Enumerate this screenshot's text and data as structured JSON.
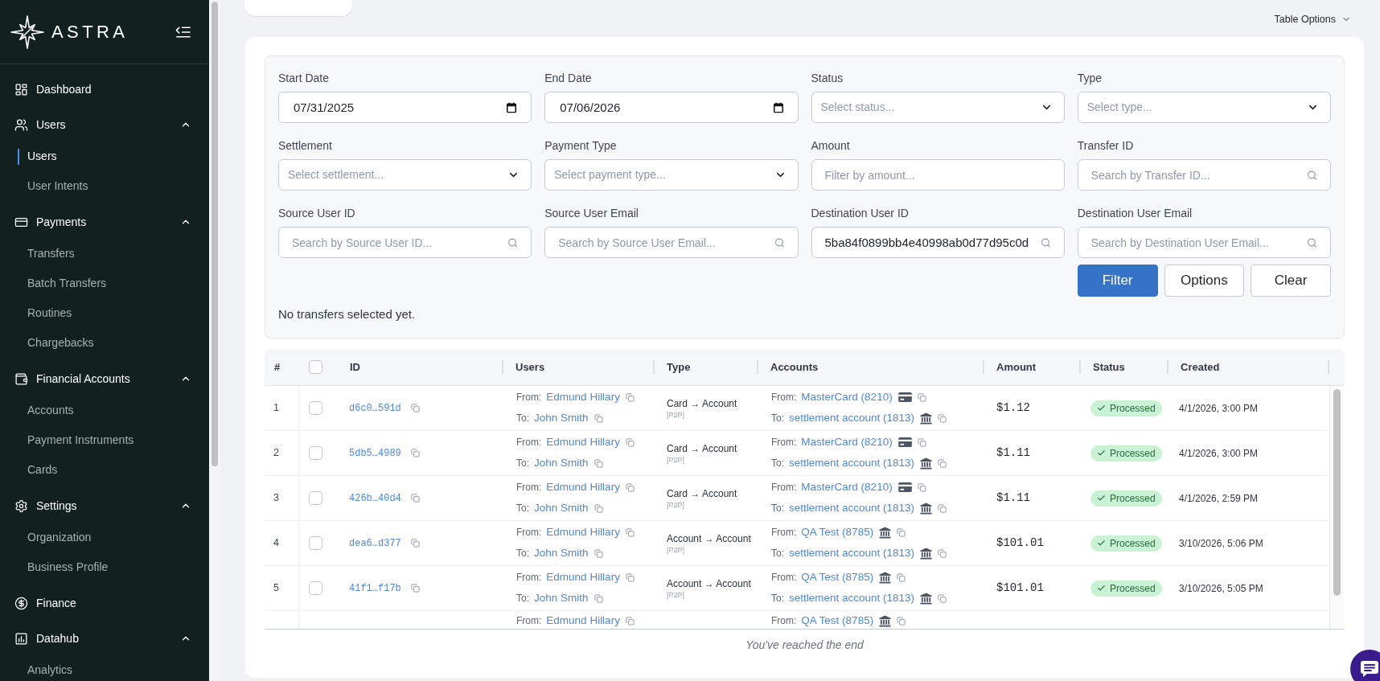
{
  "sidebar": {
    "logo": "ASTRA",
    "items": [
      {
        "label": "Dashboard",
        "kind": "link",
        "selected": false
      },
      {
        "label": "Users",
        "kind": "group",
        "expanded": true,
        "children": [
          {
            "label": "Users",
            "selected": true
          },
          {
            "label": "User Intents",
            "selected": false
          }
        ]
      },
      {
        "label": "Payments",
        "kind": "group",
        "expanded": true,
        "children": [
          {
            "label": "Transfers",
            "selected": false
          },
          {
            "label": "Batch Transfers",
            "selected": false
          },
          {
            "label": "Routines",
            "selected": false
          },
          {
            "label": "Chargebacks",
            "selected": false
          }
        ]
      },
      {
        "label": "Financial Accounts",
        "kind": "group",
        "expanded": true,
        "children": [
          {
            "label": "Accounts",
            "selected": false
          },
          {
            "label": "Payment Instruments",
            "selected": false
          },
          {
            "label": "Cards",
            "selected": false
          }
        ]
      },
      {
        "label": "Settings",
        "kind": "group",
        "expanded": true,
        "children": [
          {
            "label": "Organization",
            "selected": false
          },
          {
            "label": "Business Profile",
            "selected": false
          }
        ]
      },
      {
        "label": "Finance",
        "kind": "link",
        "selected": false
      },
      {
        "label": "Datahub",
        "kind": "group",
        "expanded": true,
        "children": [
          {
            "label": "Analytics",
            "selected": false
          }
        ]
      }
    ]
  },
  "toolbar": {
    "table_options": "Table Options"
  },
  "filters": {
    "fields": [
      {
        "label": "Start Date",
        "kind": "date",
        "value": "07/31/2025"
      },
      {
        "label": "End Date",
        "kind": "date",
        "value": "07/06/2026"
      },
      {
        "label": "Status",
        "kind": "select",
        "placeholder": "Select status..."
      },
      {
        "label": "Type",
        "kind": "select",
        "placeholder": "Select type..."
      },
      {
        "label": "Settlement",
        "kind": "select",
        "placeholder": "Select settlement..."
      },
      {
        "label": "Payment Type",
        "kind": "select",
        "placeholder": "Select payment type..."
      },
      {
        "label": "Amount",
        "kind": "text",
        "placeholder": "Filter by amount..."
      },
      {
        "label": "Transfer ID",
        "kind": "search",
        "placeholder": "Search by Transfer ID..."
      },
      {
        "label": "Source User ID",
        "kind": "search",
        "placeholder": "Search by Source User ID..."
      },
      {
        "label": "Source User Email",
        "kind": "search",
        "placeholder": "Search by Source User Email..."
      },
      {
        "label": "Destination User ID",
        "kind": "search",
        "value": "5ba84f0899bb4e40998ab0d77d95c0d"
      },
      {
        "label": "Destination User Email",
        "kind": "search",
        "placeholder": "Search by Destination User Email..."
      }
    ],
    "buttons": [
      {
        "label": "Filter",
        "kind": "primary"
      },
      {
        "label": "Options",
        "kind": "secondary"
      },
      {
        "label": "Clear",
        "kind": "secondary"
      }
    ],
    "selection_note": "No transfers selected yet."
  },
  "table": {
    "columns": [
      "#",
      "ID",
      "Users",
      "Type",
      "Accounts",
      "Amount",
      "Status",
      "Created"
    ],
    "header_checkbox": {
      "checked": false
    },
    "rows": [
      {
        "number": "1",
        "checked": false,
        "id": "d6c0…591d",
        "users": {
          "from": {
            "label": "From:",
            "name": "Edmund Hillary"
          },
          "to": {
            "label": "To:",
            "name": "John Smith"
          }
        },
        "type": {
          "text": "Card → Account",
          "tag": "[P2P]"
        },
        "accounts": {
          "from": {
            "label": "From:",
            "name": "MasterCard (8210)",
            "kind": "card"
          },
          "to": {
            "label": "To:",
            "name": "settlement account (1813)",
            "kind": "bank"
          }
        },
        "amount": "$1.12",
        "status": {
          "label": "Processed",
          "kind": "processed"
        },
        "created": "4/1/2026, 3:00 PM"
      },
      {
        "number": "2",
        "checked": false,
        "id": "5db5…4989",
        "users": {
          "from": {
            "label": "From:",
            "name": "Edmund Hillary"
          },
          "to": {
            "label": "To:",
            "name": "John Smith"
          }
        },
        "type": {
          "text": "Card → Account",
          "tag": "[P2P]"
        },
        "accounts": {
          "from": {
            "label": "From:",
            "name": "MasterCard (8210)",
            "kind": "card"
          },
          "to": {
            "label": "To:",
            "name": "settlement account (1813)",
            "kind": "bank"
          }
        },
        "amount": "$1.11",
        "status": {
          "label": "Processed",
          "kind": "processed"
        },
        "created": "4/1/2026, 3:00 PM"
      },
      {
        "number": "3",
        "checked": false,
        "id": "426b…40d4",
        "users": {
          "from": {
            "label": "From:",
            "name": "Edmund Hillary"
          },
          "to": {
            "label": "To:",
            "name": "John Smith"
          }
        },
        "type": {
          "text": "Card → Account",
          "tag": "[P2P]"
        },
        "accounts": {
          "from": {
            "label": "From:",
            "name": "MasterCard (8210)",
            "kind": "card"
          },
          "to": {
            "label": "To:",
            "name": "settlement account (1813)",
            "kind": "bank"
          }
        },
        "amount": "$1.11",
        "status": {
          "label": "Processed",
          "kind": "processed"
        },
        "created": "4/1/2026, 2:59 PM"
      },
      {
        "number": "4",
        "checked": false,
        "id": "dea6…d377",
        "users": {
          "from": {
            "label": "From:",
            "name": "Edmund Hillary"
          },
          "to": {
            "label": "To:",
            "name": "John Smith"
          }
        },
        "type": {
          "text": "Account → Account",
          "tag": "[P2P]"
        },
        "accounts": {
          "from": {
            "label": "From:",
            "name": "QA Test (8785)",
            "kind": "bank"
          },
          "to": {
            "label": "To:",
            "name": "settlement account (1813)",
            "kind": "bank"
          }
        },
        "amount": "$101.01",
        "status": {
          "label": "Processed",
          "kind": "processed"
        },
        "created": "3/10/2026, 5:06 PM"
      },
      {
        "number": "5",
        "checked": false,
        "id": "41f1…f17b",
        "users": {
          "from": {
            "label": "From:",
            "name": "Edmund Hillary"
          },
          "to": {
            "label": "To:",
            "name": "John Smith"
          }
        },
        "type": {
          "text": "Account → Account",
          "tag": "[P2P]"
        },
        "accounts": {
          "from": {
            "label": "From:",
            "name": "QA Test (8785)",
            "kind": "bank"
          },
          "to": {
            "label": "To:",
            "name": "settlement account (1813)",
            "kind": "bank"
          }
        },
        "amount": "$101.01",
        "status": {
          "label": "Processed",
          "kind": "processed"
        },
        "created": "3/10/2026, 5:05 PM"
      }
    ],
    "partial_row": {
      "users": {
        "from": {
          "label": "From:",
          "name": "Edmund Hillary"
        }
      },
      "accounts": {
        "from": {
          "label": "From:",
          "name": "QA Test (8785)",
          "kind": "bank"
        }
      }
    },
    "end_note": "You've reached the end"
  }
}
